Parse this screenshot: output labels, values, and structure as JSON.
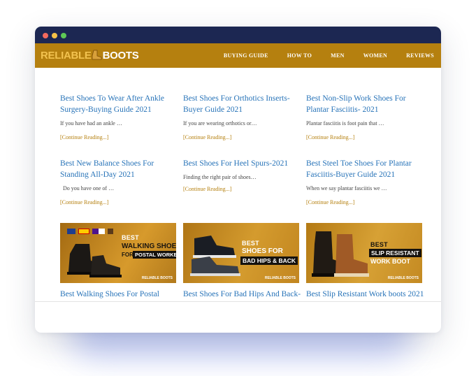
{
  "brand": {
    "logo_part1": "RELIABLE",
    "logo_part2": "BOOTS"
  },
  "nav": [
    "BUYING GUIDE",
    "HOW TO",
    "MEN",
    "WOMEN",
    "REVIEWS"
  ],
  "posts": [
    {
      "title": "Best Shoes To Wear After Ankle Surgery-Buying Guide 2021",
      "excerpt": "If you have had an ankle …",
      "more": "[Continue Reading...]"
    },
    {
      "title": "Best Shoes For Orthotics Inserts-Buyer Guide 2021",
      "excerpt": "If you are wearing orthotics or…",
      "more": "[Continue Reading...]"
    },
    {
      "title": "Best Non-Slip Work Shoes For Plantar Fasciitis- 2021",
      "excerpt": "Plantar fasciitis is foot pain that …",
      "more": "[Continue Reading...]"
    },
    {
      "title": "Best New Balance Shoes For Standing All-Day 2021",
      "excerpt": "  Do you have one of …",
      "more": "[Continue Reading...]"
    },
    {
      "title": "Best Shoes For Heel Spurs-2021",
      "excerpt": "Finding the right pair of shoes…",
      "more": "[Continue Reading...]"
    },
    {
      "title": "Best Steel Toe Shoes For Plantar Fasciitis-Buyer Guide 2021",
      "excerpt": "When we say plantar fasciitis we …",
      "more": "[Continue Reading...]"
    }
  ],
  "thumbs": [
    {
      "best": "BEST",
      "line1": "WALKING SHOES",
      "line2a": "FOR",
      "line2b": "POSTAL WORKERS",
      "brand": "RELIABLE BOOTS",
      "title": "Best Walking Shoes For Postal"
    },
    {
      "best": "BEST",
      "line1": "SHOES FOR",
      "line2b": "BAD HIPS & BACK",
      "brand": "RELIABLE BOOTS",
      "title": "Best Shoes For Bad Hips And Back-"
    },
    {
      "best": "BEST",
      "line1": "SLIP RESISTANT",
      "line2a": "WORK BOOT",
      "brand": "RELIABLE BOOTS",
      "title": "Best Slip Resistant Work boots 2021"
    }
  ],
  "colors": {
    "header": "#1c2752",
    "nav": "#b5800f",
    "link": "#2773b8",
    "more": "#b5800f"
  }
}
